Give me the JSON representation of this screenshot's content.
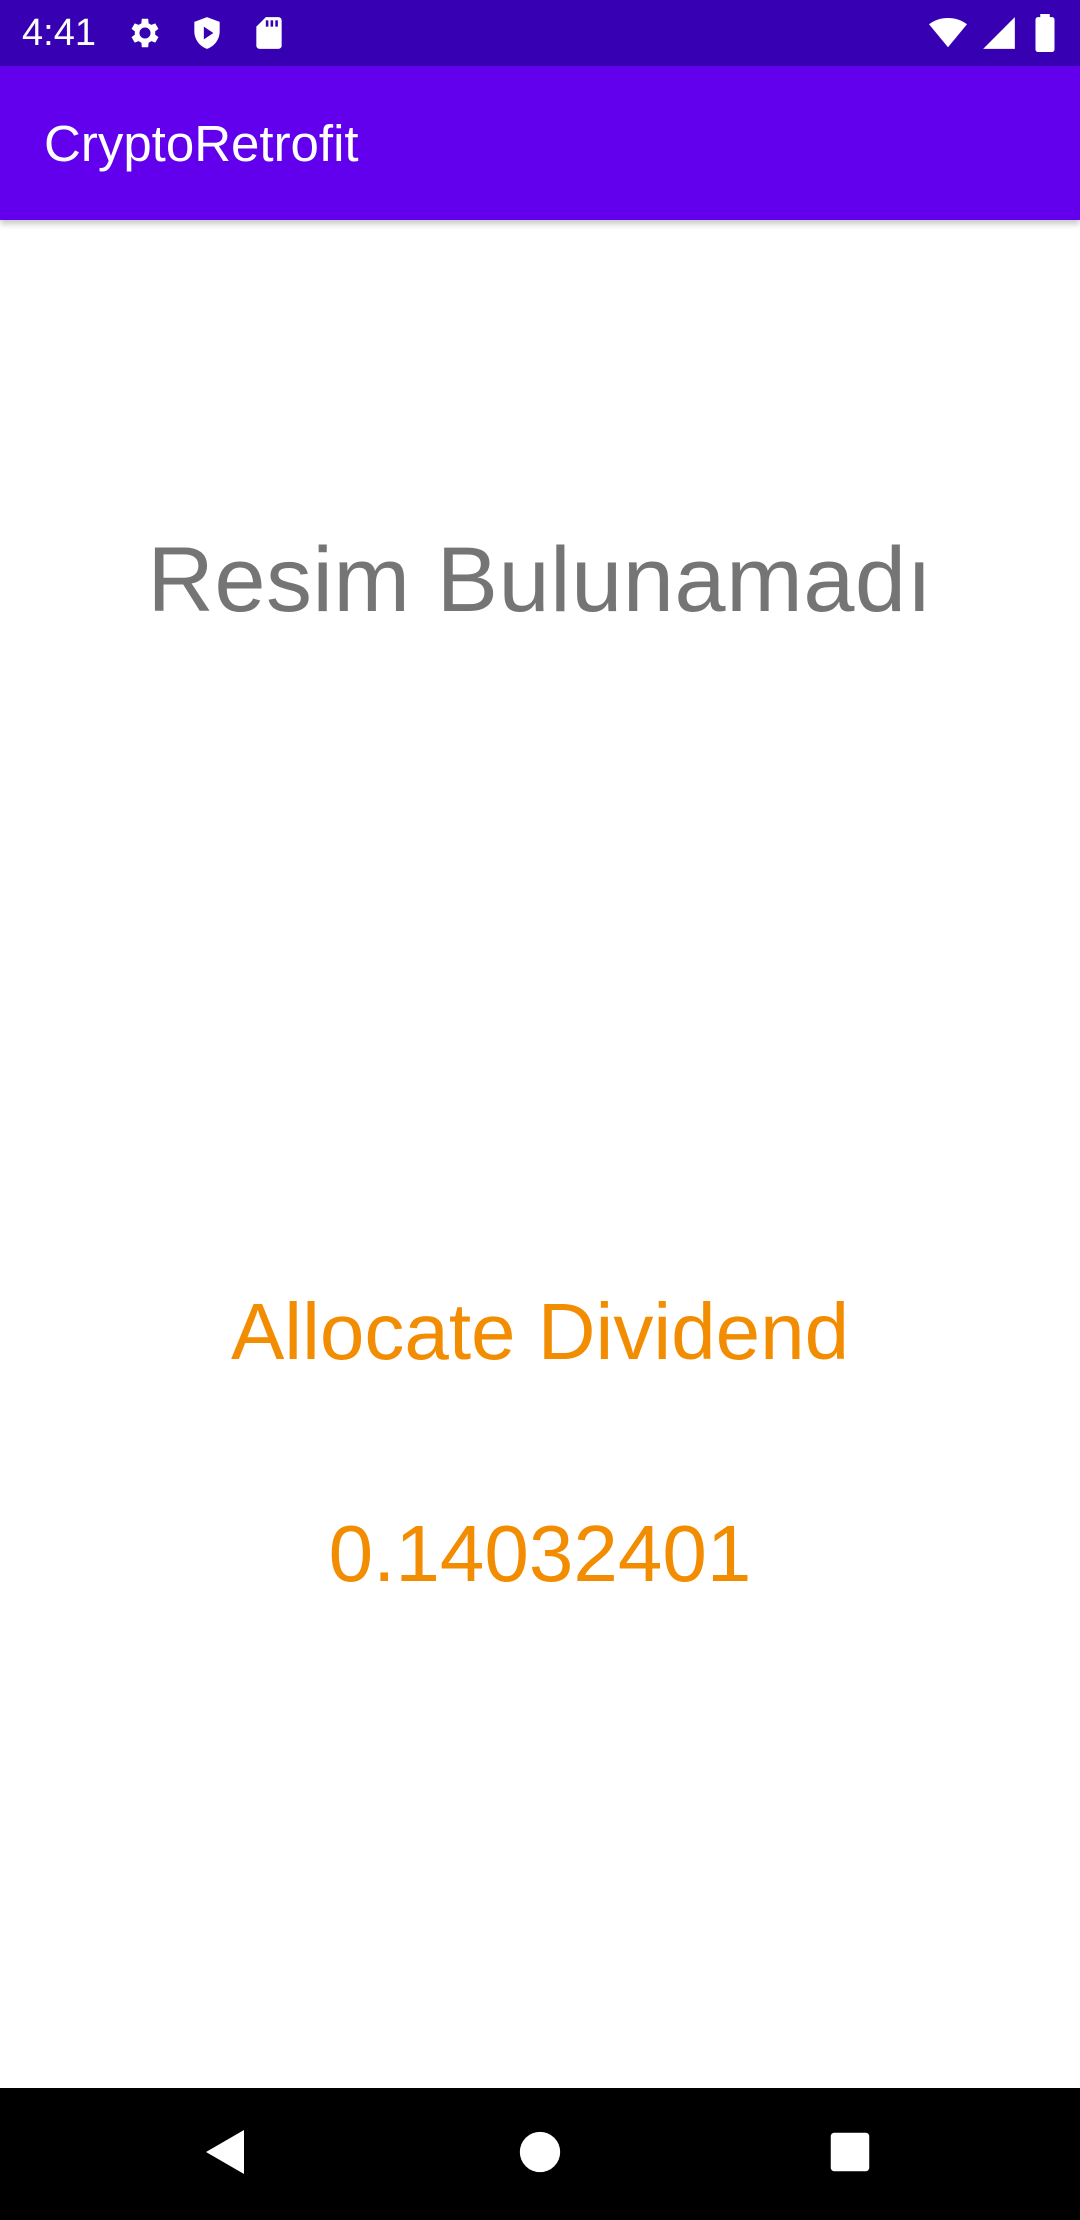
{
  "status_bar": {
    "time": "4:41",
    "left_icons": [
      "settings-icon",
      "shield-play-icon",
      "sd-card-icon"
    ],
    "right_icons": [
      "wifi-icon",
      "signal-icon",
      "battery-icon"
    ],
    "background": "#3700B3"
  },
  "app_bar": {
    "title": "CryptoRetrofit",
    "background": "#6200EE"
  },
  "content": {
    "image_placeholder_text": "Resim Bulunamadı",
    "name": "Allocate Dividend",
    "price": "0.14032401",
    "accent_color": "#F28C00"
  },
  "nav_bar": {
    "buttons": [
      "back-icon",
      "home-icon",
      "recents-icon"
    ]
  }
}
